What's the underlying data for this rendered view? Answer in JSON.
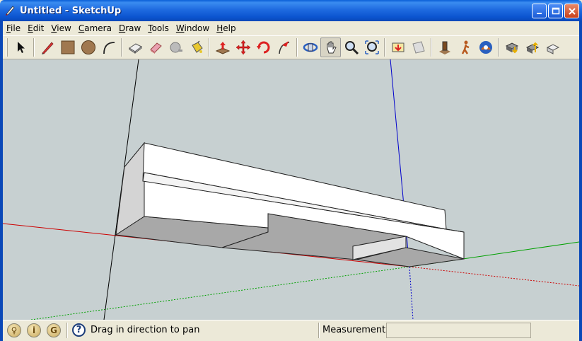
{
  "window": {
    "title": "Untitled - SketchUp",
    "controls": [
      "minimize",
      "maximize",
      "close"
    ]
  },
  "menu": [
    {
      "label": "File",
      "key": "F",
      "rest": "ile"
    },
    {
      "label": "Edit",
      "key": "E",
      "rest": "dit"
    },
    {
      "label": "View",
      "key": "V",
      "rest": "iew"
    },
    {
      "label": "Camera",
      "key": "C",
      "rest": "amera"
    },
    {
      "label": "Draw",
      "key": "D",
      "rest": "raw"
    },
    {
      "label": "Tools",
      "key": "T",
      "rest": "ools"
    },
    {
      "label": "Window",
      "key": "W",
      "rest": "indow"
    },
    {
      "label": "Help",
      "key": "H",
      "rest": "elp"
    }
  ],
  "toolbar": {
    "active_tool": "pan-tool",
    "tools": [
      "select-icon",
      "pencil-icon",
      "rectangle-icon",
      "circle-icon",
      "arc-icon",
      "make-component-icon",
      "eraser-icon",
      "tape-measure-icon",
      "paint-bucket-icon",
      "push-pull-icon",
      "move-icon",
      "rotate-icon",
      "follow-me-icon",
      "orbit-icon",
      "pan-icon",
      "zoom-icon",
      "zoom-extents-icon",
      "previous-view-icon",
      "next-view-icon",
      "position-camera-icon",
      "walk-icon",
      "look-around-icon",
      "get-models-icon",
      "share-model-icon",
      "share-component-icon"
    ]
  },
  "statusbar": {
    "hint": "Drag in direction to pan",
    "measurements_label": "Measurements",
    "measurements_value": "",
    "icons": [
      "geo-location-icon",
      "credits-icon",
      "user-icon"
    ]
  },
  "colors": {
    "viewport_bg": "#C7D0D1",
    "axis_red": "#CC0000",
    "axis_green": "#00A000",
    "axis_blue": "#0000CC",
    "face_light": "#FFFFFF",
    "face_dark": "#A9A9A9"
  }
}
